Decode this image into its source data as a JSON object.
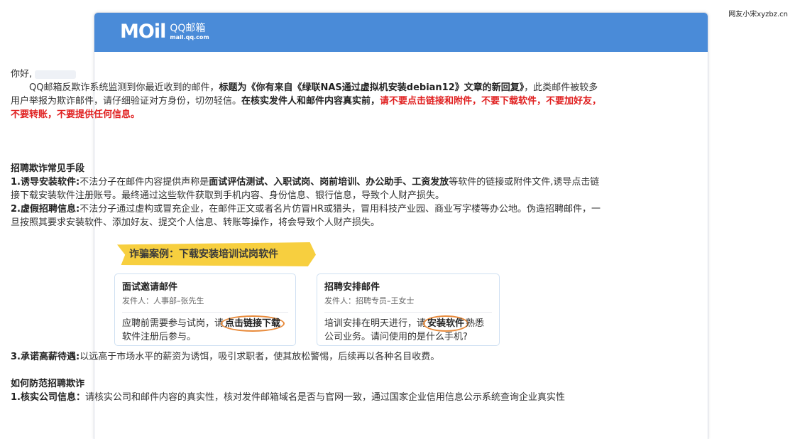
{
  "watermark": "网友小宋xyzbz.cn",
  "header": {
    "logo_mark": "MOil",
    "brand": "QQ邮箱",
    "domain": "mail.qq.com"
  },
  "body": {
    "greeting": "你好,",
    "intro_prefix": "QQ邮箱反欺诈系统监测到你最近收到的邮件，",
    "intro_title_bold": "标题为《你有来自《绿联NAS通过虚拟机安装debian12》文章的新回复》",
    "intro_suffix": "，此类邮件被较多用户举报为欺诈邮件，请仔细验证对方身份，切勿轻信。",
    "verify_bold": "在核实发件人和邮件内容真实前，",
    "warning_red": "请不要点击链接和附件，不要下载软件，不要加好友，不要转账，不要提供任何信息。",
    "section1_title": "招聘欺诈常见手段",
    "item1_label": "1.诱导安装软件:",
    "item1_text_a": "不法分子在邮件内容提供声称是",
    "item1_bold": "面试评估测试、入职试岗、岗前培训、办公助手、工资发放",
    "item1_text_b": "等软件的链接或附件文件,诱导点击链接下载安装软件注册账号。最终通过这些软件获取到手机内容、身份信息、银行信息，导致个人财产损失。",
    "item2_label": "2.虚假招聘信息:",
    "item2_text": "不法分子通过虚构或冒充企业，在邮件正文或者名片仿冒HR或猎头，冒用科技产业园、商业写字楼等办公地。伪造招聘邮件，一旦按照其要求安装软件、添加好友、提交个人信息、转账等操作，将会导致个人财产损失。"
  },
  "case": {
    "banner": "诈骗案例：下载安装培训试岗软件",
    "left": {
      "title": "面试邀请邮件",
      "sender": "发件人：人事部–张先生",
      "text_a": "应聘前需要参与试岗，请",
      "circled": "点击链接下载",
      "text_b": "软件注册后参与。"
    },
    "right": {
      "title": "招聘安排邮件",
      "sender": "发件人：招聘专员–王女士",
      "text_a": "培训安排在明天进行，请",
      "circled": "安装软件",
      "text_b": "熟悉公司业务。请问使用的是什么手机?"
    }
  },
  "lower": {
    "item3_label": "3.承诺高薪待遇:",
    "item3_text": "以远高于市场水平的薪资为诱饵，吸引求职者，使其放松警惕，后续再以各种名目收费。",
    "section2_title": "如何防范招聘欺诈",
    "tip1_label": "1.核实公司信息：",
    "tip1_text": "请核实公司和邮件内容的真实性，核对发件邮箱域名是否与官网一致，通过国家企业信用信息公示系统查询企业真实性"
  }
}
